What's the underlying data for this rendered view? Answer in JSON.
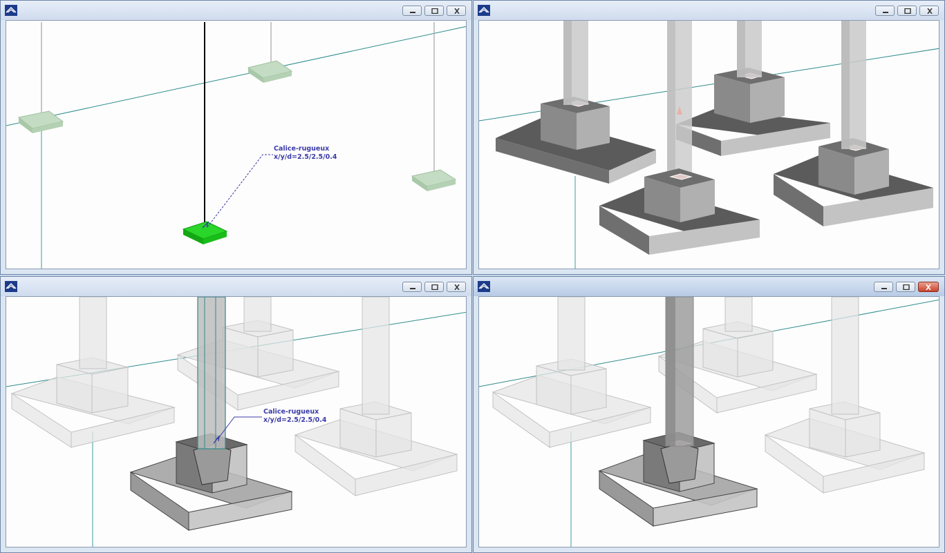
{
  "windows": {
    "top_left": {
      "annotation": {
        "line1": "Calice-rugueux",
        "line2": "x/y/d=2.5/2.5/0.4"
      }
    },
    "bottom_left": {
      "annotation": {
        "line1": "Calice-rugueux",
        "line2": "x/y/d=2.5/2.5/0.4"
      }
    }
  },
  "icons": {
    "app": "app-icon",
    "minimize": "minimize-icon",
    "restore": "restore-icon",
    "close": "close-icon"
  },
  "colors": {
    "grid_line": "#2e8b8b",
    "selected_footing": "#1fc81f",
    "annotation_text": "#3a3aa8",
    "close_active": "#c7442c"
  }
}
